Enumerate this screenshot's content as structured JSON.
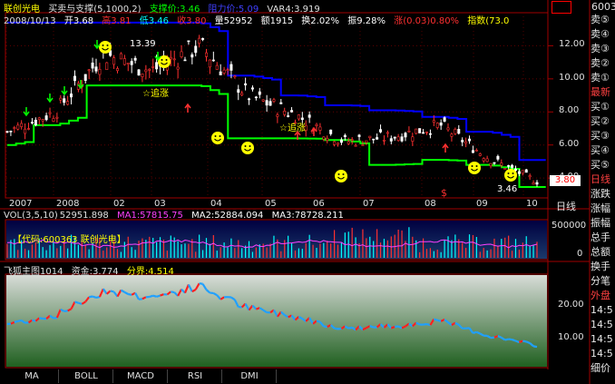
{
  "header": {
    "stock_name": "联创光电",
    "indicator": "买卖与支撑",
    "params": "(5,1000,2)",
    "support": "支撑价:3.46",
    "resistance": "阻力价:5.09",
    "var4": "VAR4:3.919",
    "code": "60036"
  },
  "info_line": {
    "date": "2008/10/13",
    "open": "开3.68",
    "high": "高3.81",
    "low": "低3.46",
    "close": "收3.80",
    "volume": "量52952",
    "amount": "额1915",
    "turnover": "换2.02%",
    "amplitude": "振9.28%",
    "change": "涨(0.03)0.80%",
    "index": "指数(73.0"
  },
  "price_axis": [
    "12.00",
    "10.00",
    "8.00",
    "6.00",
    "4.00"
  ],
  "price_labels": {
    "high_mark": "13.39",
    "low_mark": "3.46",
    "current": "3.80",
    "pursue_1": "☆追涨",
    "pursue_2": "☆追涨"
  },
  "time_axis": [
    "2007",
    "2008",
    "02",
    "03",
    "04",
    "05",
    "06",
    "07",
    "08",
    "09",
    "10"
  ],
  "axis_mode": "日线",
  "vol_line": {
    "title": "VOL(3,5,10)",
    "value": "52951.898",
    "ma1": "MA1:57815.75",
    "ma2": "MA2:52884.094",
    "ma3": "MA3:78728.211"
  },
  "vol_axis": [
    "500000",
    "0"
  ],
  "vol_box_label": "【代码:600363 联创光电】",
  "sub_line": {
    "title": "飞狐主图1014",
    "capital": "资金:3.774",
    "boundary": "分界:4.514"
  },
  "sub_axis": [
    "20.00",
    "10.00"
  ],
  "tabs": [
    "MA",
    "BOLL",
    "MACD",
    "RSI",
    "DMI"
  ],
  "side_panel": [
    "卖⑤",
    "卖④",
    "卖③",
    "卖②",
    "卖①",
    "最新",
    "买①",
    "买②",
    "买③",
    "买④",
    "买⑤",
    "日线",
    "涨跌",
    "涨幅",
    "振幅",
    "总手",
    "总额",
    "换手",
    "分笔",
    "外盘",
    "14:5",
    "14:5",
    "14:5",
    "14:5",
    "细价"
  ],
  "colors": {
    "up": "#ff3030",
    "down": "#00ffff",
    "support_line": "#00ff00",
    "resistance_line": "#0000ff",
    "grid_red": "#a00000",
    "sub_fill_top": "#e8e8e8",
    "sub_fill_bottom": "#207020"
  },
  "chart_data": {
    "type": "line",
    "x": [
      "2007-11",
      "2007-12",
      "2008-01",
      "2008-02",
      "2008-03",
      "2008-04",
      "2008-05",
      "2008-06",
      "2008-07",
      "2008-08",
      "2008-09",
      "2008-10"
    ],
    "series": [
      {
        "name": "收",
        "values": [
          6.8,
          8.0,
          11.5,
          10.5,
          12.0,
          9.0,
          7.8,
          6.2,
          6.5,
          7.2,
          5.2,
          3.8
        ]
      },
      {
        "name": "支撑价",
        "values": [
          6.0,
          7.2,
          9.6,
          9.6,
          9.6,
          6.4,
          6.4,
          6.3,
          4.8,
          5.1,
          4.8,
          3.46
        ]
      },
      {
        "name": "阻力价",
        "values": [
          13.4,
          13.4,
          13.4,
          13.4,
          13.4,
          10.2,
          9.0,
          8.4,
          8.1,
          7.7,
          6.8,
          5.09
        ]
      }
    ],
    "ylim": [
      3,
      14
    ]
  }
}
